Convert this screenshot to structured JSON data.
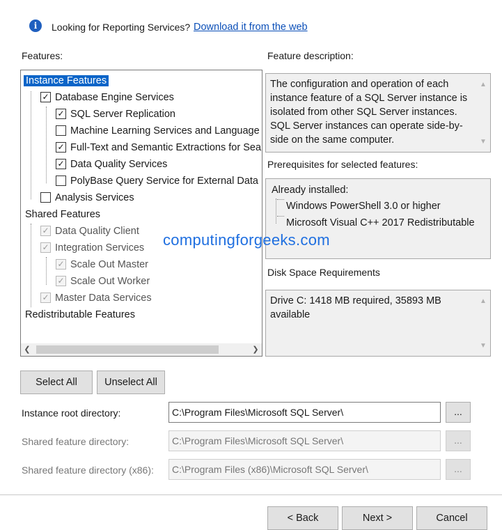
{
  "notice": {
    "text": "Looking for Reporting Services?",
    "link": "Download it from the web"
  },
  "features": {
    "label": "Features:",
    "tree": [
      {
        "label": "Instance Features",
        "checkbox": false,
        "selected": true
      },
      {
        "label": "Database Engine Services",
        "checked": true
      },
      {
        "label": "SQL Server Replication",
        "checked": true
      },
      {
        "label": "Machine Learning Services and Language Ext",
        "checked": false
      },
      {
        "label": "Full-Text and Semantic Extractions for Search",
        "checked": true
      },
      {
        "label": "Data Quality Services",
        "checked": true
      },
      {
        "label": "PolyBase Query Service for External Data",
        "checked": false
      },
      {
        "label": "Analysis Services",
        "checked": false
      },
      {
        "label": "Shared Features",
        "checkbox": false
      },
      {
        "label": "Data Quality Client",
        "checked": true,
        "disabled": true
      },
      {
        "label": "Integration Services",
        "checked": true,
        "disabled": true
      },
      {
        "label": "Scale Out Master",
        "checked": true,
        "disabled": true
      },
      {
        "label": "Scale Out Worker",
        "checked": true,
        "disabled": true
      },
      {
        "label": "Master Data Services",
        "checked": true,
        "disabled": true
      },
      {
        "label": "Redistributable Features",
        "checkbox": false
      }
    ]
  },
  "description": {
    "label": "Feature description:",
    "text": "The configuration and operation of each instance feature of a SQL Server instance is isolated from other SQL Server instances. SQL Server instances can operate side-by-side on the same computer."
  },
  "prerequisites": {
    "label": "Prerequisites for selected features:",
    "header": "Already installed:",
    "items": [
      "Windows PowerShell 3.0 or higher",
      "Microsoft Visual C++ 2017 Redistributable"
    ]
  },
  "disk": {
    "label": "Disk Space Requirements",
    "text": "Drive C: 1418 MB required, 35893 MB available"
  },
  "watermark": "computingforgeeks.com",
  "buttons": {
    "select_all": "Select All",
    "unselect_all": "Unselect All",
    "back": "< Back",
    "next": "Next >",
    "cancel": "Cancel",
    "browse": "..."
  },
  "directories": [
    {
      "label": "Instance root directory:",
      "value": "C:\\Program Files\\Microsoft SQL Server\\",
      "disabled": false
    },
    {
      "label": "Shared feature directory:",
      "value": "C:\\Program Files\\Microsoft SQL Server\\",
      "disabled": true
    },
    {
      "label": "Shared feature directory (x86):",
      "value": "C:\\Program Files (x86)\\Microsoft SQL Server\\",
      "disabled": true
    }
  ],
  "colors": {
    "selection": "#0a64c8",
    "link": "#0b4fb8",
    "watermark": "#1f6fe0"
  }
}
